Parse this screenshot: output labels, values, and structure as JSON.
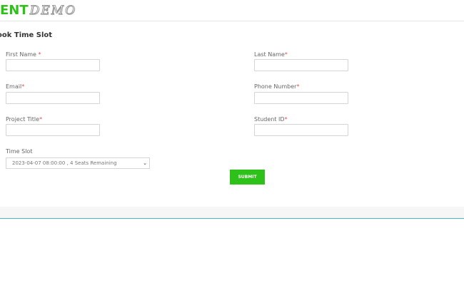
{
  "header": {
    "logo_bold": "ENT",
    "logo_script": "DEMO"
  },
  "page": {
    "title": "ook Time Slot"
  },
  "form": {
    "first_name": {
      "label": "First Name ",
      "required": "*"
    },
    "last_name": {
      "label": "Last Name",
      "required": "*"
    },
    "email": {
      "label": "Email",
      "required": "*"
    },
    "phone": {
      "label": "Phone Number",
      "required": "*"
    },
    "project_title": {
      "label": "Project Title",
      "required": "*"
    },
    "student_id": {
      "label": "Student ID",
      "required": "*"
    },
    "time_slot": {
      "label": "Time Slot",
      "selected": "2023-04-07 08:00:00 , 4 Seats Remaining"
    },
    "submit_label": "SUBMIT"
  },
  "colors": {
    "accent": "#2ec11a",
    "required": "#d9534f",
    "footer_line": "#4bb8c9"
  }
}
